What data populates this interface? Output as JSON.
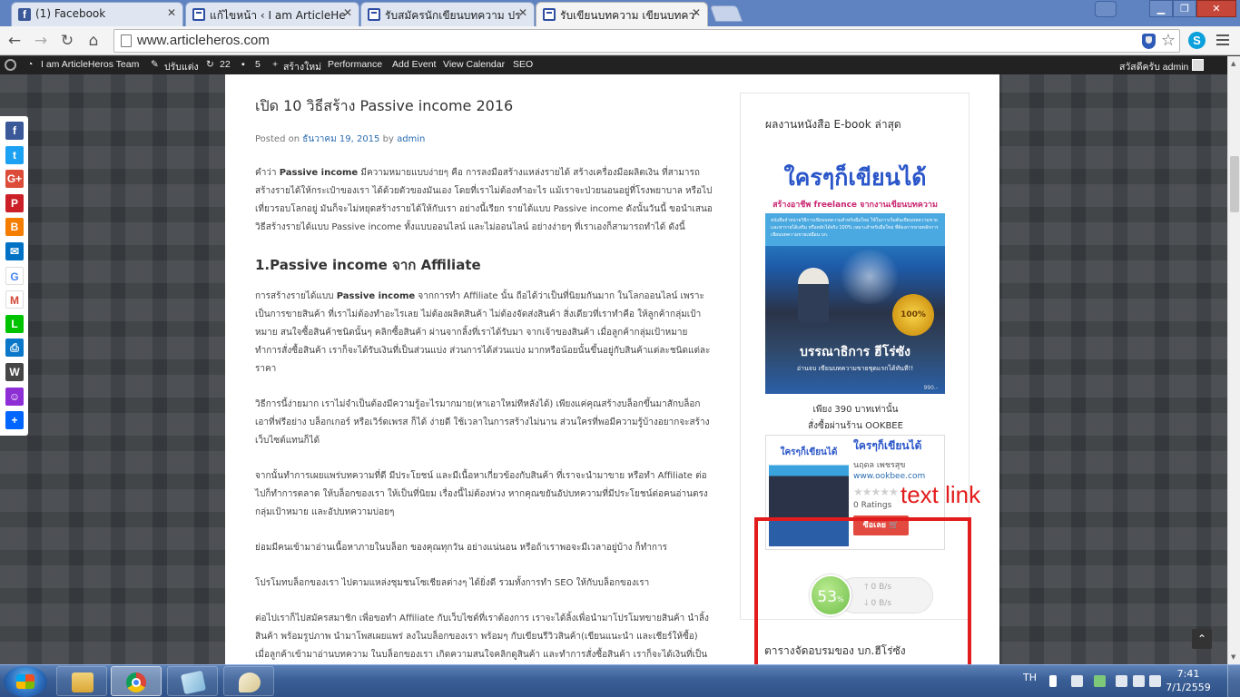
{
  "tabs": [
    {
      "title": "(1) Facebook",
      "icon": "facebook-icon",
      "active": false
    },
    {
      "title": "แก้ไขหน้า ‹ I am ArticleHeros",
      "icon": "wordpress-page-icon",
      "active": false
    },
    {
      "title": "รับสมัครนักเขียนบทความ ประ",
      "icon": "wordpress-page-icon",
      "active": false
    },
    {
      "title": "รับเขียนบทความ เขียนบทควา",
      "icon": "wordpress-page-icon",
      "active": true
    }
  ],
  "address": {
    "url": "www.articleheros.com"
  },
  "adminbar": {
    "site": "I am ArticleHeros Team",
    "customize": "ปรับแต่ง",
    "updates": "22",
    "comments": "5",
    "new": "สร้างใหม่",
    "performance": "Performance",
    "add_event": "Add Event",
    "view_calendar": "View Calendar",
    "seo": "SEO",
    "greeting": "สวัสดีครับ admin"
  },
  "share_icons": [
    "facebook-icon",
    "twitter-icon",
    "google-plus-icon",
    "pinterest-icon",
    "blogger-icon",
    "email-icon",
    "google-icon",
    "gmail-icon",
    "line-icon",
    "print-icon",
    "wordpress-icon",
    "mixi-icon",
    "share-more-icon"
  ],
  "share_colors": [
    "#3b5998",
    "#1da1f2",
    "#dd4b39",
    "#cb2027",
    "#f57d00",
    "#0072c6",
    "#ffffff",
    "#ffffff",
    "#00c300",
    "#0b77c9",
    "#464646",
    "#8e2fd5",
    "#0166ff"
  ],
  "share_glyphs": [
    "f",
    "t",
    "G+",
    "P",
    "B",
    "✉",
    "G",
    "M",
    "L",
    "⎙",
    "W",
    "☺",
    "+"
  ],
  "post": {
    "title": "เปิด 10 วิธีสร้าง Passive income 2016",
    "meta_prefix": "Posted on",
    "date": "ธันวาคม 19, 2015",
    "by": "by",
    "author": "admin",
    "p1_pre": "คำว่า ",
    "p1_bold": "Passive income",
    "p1_post": " มีความหมายแบบง่ายๆ คือ การลงมือสร้างแหล่งรายได้ สร้างเครื่องมือผลิตเงิน ที่สามารถสร้างรายได้ให้กระเป๋าของเรา ได้ด้วยตัวของมันเอง โดยที่เราไม่ต้องทำอะไร แม้เราจะป่วยนอนอยู่ที่โรงพยาบาล หรือไปเที่ยวรอบโลกอยู่ มันก็จะไม่หยุดสร้างรายได้ให้กับเรา อย่างนี้เรียก รายได้แบบ Passive income ดังนั้นวันนี้ ขอนำเสนอ วิธีสร้างรายได้แบบ Passive income ทั้งแบบออนไลน์ และไม่ออนไลน์ อย่างง่ายๆ ที่เราเองก็สามารถทำได้ ดังนี้",
    "h2": "1.Passive income จาก Affiliate",
    "p2_pre": "การสร้างรายได้แบบ ",
    "p2_bold": "Passive income",
    "p2_post": " จากการทำ Affiliate นั้น ถือได้ว่าเป็นที่นิยมกันมาก ในโลกออนไลน์ เพราะเป็นการขายสินค้า ที่เราไม่ต้องทำอะไรเลย ไม่ต้องผลิตสินค้า ไม่ต้องจัดส่งสินค้า สิ่งเดียวที่เราทำคือ ให้ลูกค้ากลุ่มเป้าหมาย สนใจซื้อสินค้าชนิดนั้นๆ คลิกซื้อสินค้า ผ่านจากลิ้งที่เราได้รับมา จากเจ้าของสินค้า เมื่อลูกค้ากลุ่มเป้าหมายทำการสั่งซื้อสินค้า เราก็จะได้รับเงินที่เป็นส่วนแบ่ง ส่วนการได้ส่วนแบ่ง มากหรือน้อยนั้นขึ้นอยู่กับสินค้าแต่ละชนิดแต่ละราคา",
    "p3": "วิธีการนี้ง่ายมาก เราไม่จำเป็นต้องมีความรู้อะไรมากมาย(หาเอาใหม่ทีหลังได้) เพียงแค่คุณสร้างบล็อกขึ้นมาสักบล็อก เอาที่ฟรีอย่าง บล็อกเกอร์ หรือเวิร์ดเพรส ก็ได้ ง่ายดี ใช้เวลาในการสร้างไม่นาน ส่วนใครที่พอมีความรู้บ้างอยากจะสร้างเว็บไซต์แทนก็ได้",
    "p4": "จากนั้นทำการเผยแพร่บทความที่ดี มีประโยชน์ และมีเนื้อหาเกี่ยวข้องกับสินค้า ที่เราจะนำมาขาย หรือทำ Affiliate ต่อไปก็ทำการตลาด ให้บล็อกของเรา ให้เป็นที่นิยม เรื่องนี้ไม่ต้องห่วง หากคุณขยันอัปบทความที่มีประโยชน์ต่อคนอ่านตรงกลุ่มเป้าหมาย และอัปบทความบ่อยๆ",
    "p5": "ย่อมมีคนเข้ามาอ่านเนื้อหาภายในบล็อก ของคุณทุกวัน อย่างแน่นอน หรือถ้าเราพอจะมีเวลาอยู่บ้าง ก็ทำการ",
    "p6": "โปรโมทบล็อกของเรา ไปตามแหล่งชุมชนโซเชียลต่างๆ ได้ยิ่งดี รวมทั้งการทำ SEO ให้กับบล็อกของเรา",
    "p7": "ต่อไปเราก็ไปสมัครสมาชิก เพื่อขอทำ Affiliate กับเว็บไซต์ที่เราต้องการ เราจะได้ลิ้งเพื่อนำมาโปรโมทขายสินค้า นำลิ้งสินค้า พร้อมรูปภาพ นำมาโพสเผยแพร่ ลงในบล็อกของเรา พร้อมๆ กับเขียนรีวิวสินค้า(เขียนแนะนำ และเชียร์ให้ซื้อ) เมื่อลูกค้าเข้ามาอ่านบทความ ในบล็อกของเรา เกิดความสนใจคลิกดูสินค้า และทำการสั่งซื้อสินค้า เราก็จะได้เงินที่เป็นส่วนแบ่ง"
  },
  "sidebar": {
    "widget_title": "ผลงานหนังสือ E-book ล่าสุด",
    "book": {
      "title": "ใครๆก็เขียนได้",
      "subtitle": "สร้างอาชีพ freelance จากงานเขียนบทความ",
      "banner": "หนังสือจำหน่ายวิธีการเขียนบทความสำหรับมือใหม่ ใช้ในการเริ่มต้นเขียนบทความขาย และหารายได้เสริม หรือหลักได้จริง 100% เหมาะสำหรับมือใหม่ ที่ต้องการขายหลักการเขียนบทความขายเหมือน บก.",
      "seal": "100%",
      "author": "บรรณาธิการ ฮีโร่ซัง",
      "tagline": "อ่านจบ เขียนบทความขายชุดแรกได้ทันที!!",
      "price": "990.-"
    },
    "price_line1": "เพียง 390 บาทเท่านั้น",
    "price_line2": "สั่งซื้อผ่านร้าน OOKBEE",
    "ookbee": {
      "cover_title": "ใครๆก็เขียนได้",
      "title": "ใครๆก็เขียนได้",
      "author": "นฤดล เพชรสุข",
      "site": "www.ookbee.com",
      "stars": "★★★★★",
      "ratings": "0 Ratings",
      "buy": "ซื้อเลย 🛒"
    },
    "speed": {
      "percent": "53",
      "unit": "%",
      "up": "0 B/s",
      "down": "0 B/s"
    },
    "widget2_title": "ตารางจัดอบรมของ บก.ฮีโร่ซัง"
  },
  "annotation": {
    "label": "text link",
    "color": "#e21c1c"
  },
  "taskbar": {
    "lang": "TH",
    "time": "7:41",
    "date": "7/1/2559"
  }
}
